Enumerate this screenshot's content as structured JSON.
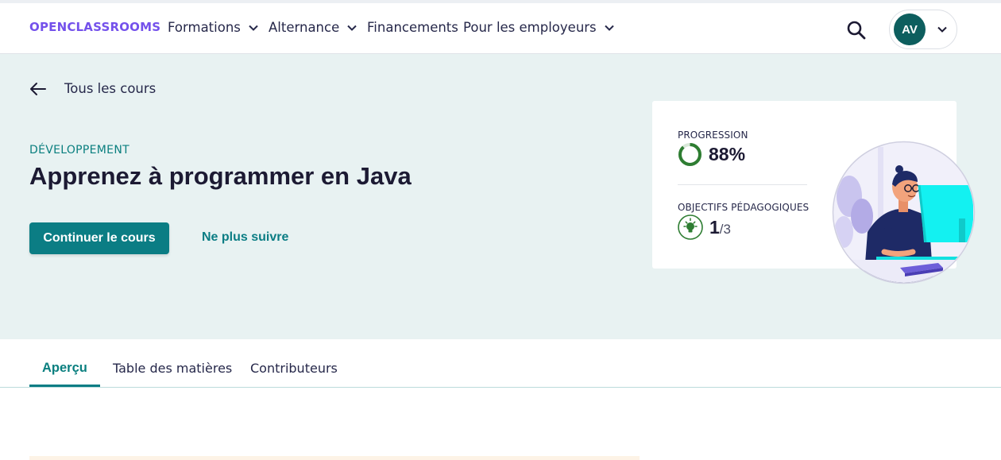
{
  "header": {
    "logo": "OPENCLASSROOMS",
    "nav": [
      {
        "label": "Formations",
        "has_dropdown": true
      },
      {
        "label": "Alternance",
        "has_dropdown": true
      },
      {
        "label": "Financements",
        "has_dropdown": false
      },
      {
        "label": "Pour les employeurs",
        "has_dropdown": true
      }
    ],
    "search_icon": "search-icon",
    "user_initials": "AV"
  },
  "hero": {
    "back_label": "Tous les cours",
    "category": "DÉVELOPPEMENT",
    "title": "Apprenez à programmer en Java",
    "continue_label": "Continuer le cours",
    "unfollow_label": "Ne plus suivre",
    "progress_label": "PROGRESSION",
    "progress_value": "88%",
    "progress_fraction": 0.88,
    "objectives_label": "OBJECTIFS PÉDAGOGIQUES",
    "objectives_done": "1",
    "objectives_total": "/3",
    "colors": {
      "accent": "#0b7d84",
      "hero_bg": "#e8f2f2",
      "brand": "#7451eb",
      "progress": "#2e7d32"
    }
  },
  "tabs": [
    {
      "label": "Aperçu",
      "active": true
    },
    {
      "label": "Table des matières",
      "active": false
    },
    {
      "label": "Contributeurs",
      "active": false
    }
  ]
}
